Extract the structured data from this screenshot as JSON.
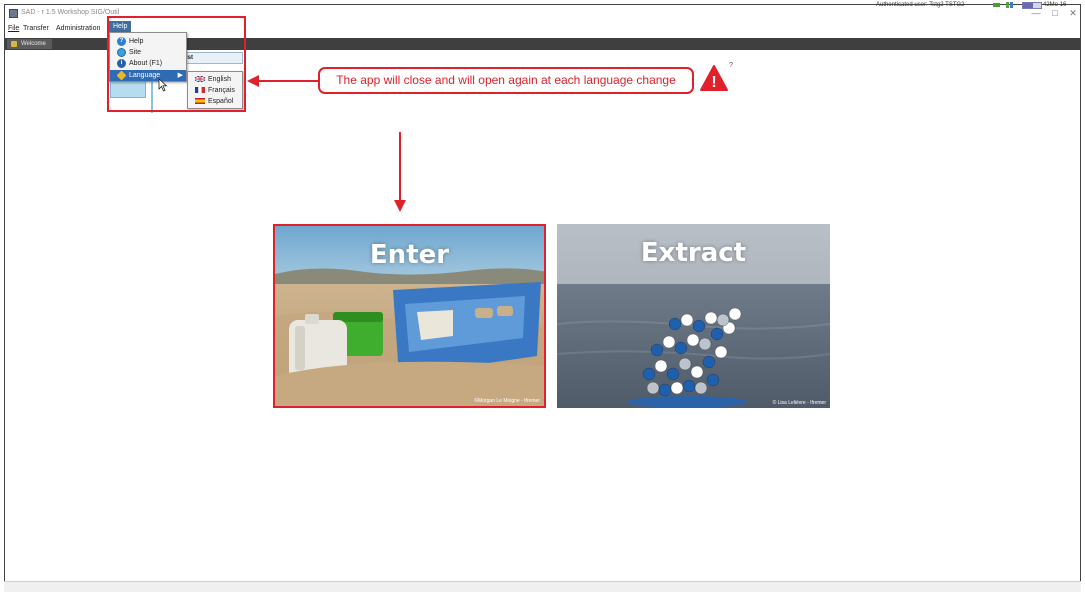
{
  "window": {
    "title": "SAD - r 1.5 Workshop SIG/Outil",
    "controls": [
      "—",
      "□",
      "✕"
    ]
  },
  "menubar": {
    "items": [
      {
        "label": "File",
        "mnemonic": "F"
      },
      {
        "label": "Transfer",
        "mnemonic": "T"
      },
      {
        "label": "Administration",
        "mnemonic": "A"
      }
    ],
    "help_label": "Help"
  },
  "tab": {
    "label": "Welcome"
  },
  "background_panel": {
    "label": "ist"
  },
  "help_menu": {
    "items": [
      {
        "label": "Help",
        "icon": "help-icon"
      },
      {
        "label": "Site",
        "icon": "globe-icon"
      },
      {
        "label": "About (F1)",
        "icon": "info-icon"
      },
      {
        "label": "Language",
        "icon": "language-icon",
        "has_submenu": true
      }
    ]
  },
  "language_submenu": {
    "items": [
      {
        "label": "English",
        "flag": "uk-flag-icon"
      },
      {
        "label": "Français",
        "flag": "france-flag-icon"
      },
      {
        "label": "Español",
        "flag": "spain-flag-icon"
      }
    ]
  },
  "annotation": {
    "callout_text": "The app will close and will open again at each language change",
    "warning_glyph": "!",
    "qmark": "?",
    "color": "#e0202a"
  },
  "cards": [
    {
      "title": "Enter",
      "credit": "©Morgan Le Moigne - Ifremer"
    },
    {
      "title": "Extract",
      "credit": "© Lisa Lelièvre - Ifremer"
    }
  ],
  "statusbar": {
    "user_text": "Authenticated user: Tstg2 TSTG2",
    "memory_fill": 0.55,
    "memory_text": "42Mo 16"
  }
}
